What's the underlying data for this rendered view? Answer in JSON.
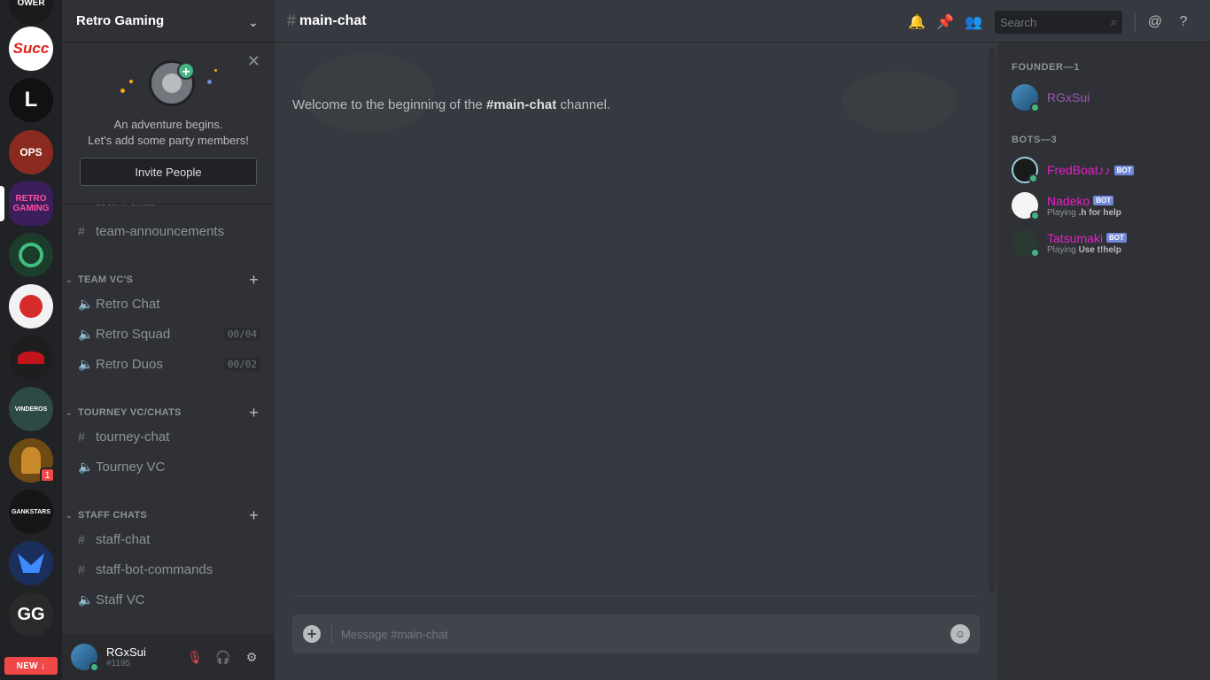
{
  "servers": [
    {
      "label": "OWER",
      "color": "#1a1a1a"
    },
    {
      "label": "Succ",
      "color": "#ffffff",
      "text_color": "#e0221a"
    },
    {
      "label": "L",
      "color": "#111111"
    },
    {
      "label": "OPS",
      "color": "#8b2b1f"
    },
    {
      "label": "RETRO GAMING",
      "color": "#3a1f5c",
      "text_color": "#ff4fa0"
    },
    {
      "label": "",
      "color": "#1c3d2c"
    },
    {
      "label": "",
      "color": "#f2f2f2"
    },
    {
      "label": "",
      "color": "#1e1e1e"
    },
    {
      "label": "VINDEROS",
      "color": "#2d4a44"
    },
    {
      "label": "",
      "color": "#6e4b15"
    },
    {
      "label": "GANKSTARS",
      "color": "#161616"
    },
    {
      "label": "",
      "color": "#1b2f5c"
    },
    {
      "label": "GG",
      "color": "#2a2a2a"
    }
  ],
  "server_badge": "1",
  "new_button": "NEW",
  "guild": {
    "name": "Retro Gaming"
  },
  "invite": {
    "line1": "An adventure begins.",
    "line2": "Let's add some party members!",
    "button": "Invite People"
  },
  "channels": {
    "partial_top": "team-chat",
    "team_announcements": "team-announcements",
    "cat_team_vc": "TEAM VC'S",
    "retro_chat": "Retro Chat",
    "retro_squad": "Retro Squad",
    "retro_squad_count": "00/04",
    "retro_duos": "Retro Duos",
    "retro_duos_count": "00/02",
    "cat_tourney": "TOURNEY VC/CHATS",
    "tourney_chat": "tourney-chat",
    "tourney_vc": "Tourney VC",
    "cat_staff": "STAFF CHATS",
    "staff_chat": "staff-chat",
    "staff_bot_commands": "staff-bot-commands",
    "staff_vc": "Staff VC"
  },
  "user": {
    "name": "RGxSui",
    "tag": "#1195"
  },
  "channel_header": {
    "name": "main-chat",
    "search_placeholder": "Search"
  },
  "welcome": {
    "prefix": "Welcome to the beginning of the ",
    "channel": "#main-chat",
    "suffix": " channel."
  },
  "composer": {
    "placeholder": "Message #main-chat"
  },
  "members": {
    "founder_header": "FOUNDER—1",
    "bots_header": "BOTS—3",
    "founder": {
      "name": "RGxSui",
      "color": "#9b59b6"
    },
    "bots": [
      {
        "name": "FredBoat♪♪",
        "color": "#e91ec8",
        "tag": "BOT",
        "activity_prefix": "",
        "activity": ""
      },
      {
        "name": "Nadeko",
        "color": "#e91ec8",
        "tag": "BOT",
        "activity_prefix": "Playing ",
        "activity": ".h for help"
      },
      {
        "name": "Tatsumaki",
        "color": "#e91ec8",
        "tag": "BOT",
        "activity_prefix": "Playing ",
        "activity": "Use t!help"
      }
    ]
  }
}
